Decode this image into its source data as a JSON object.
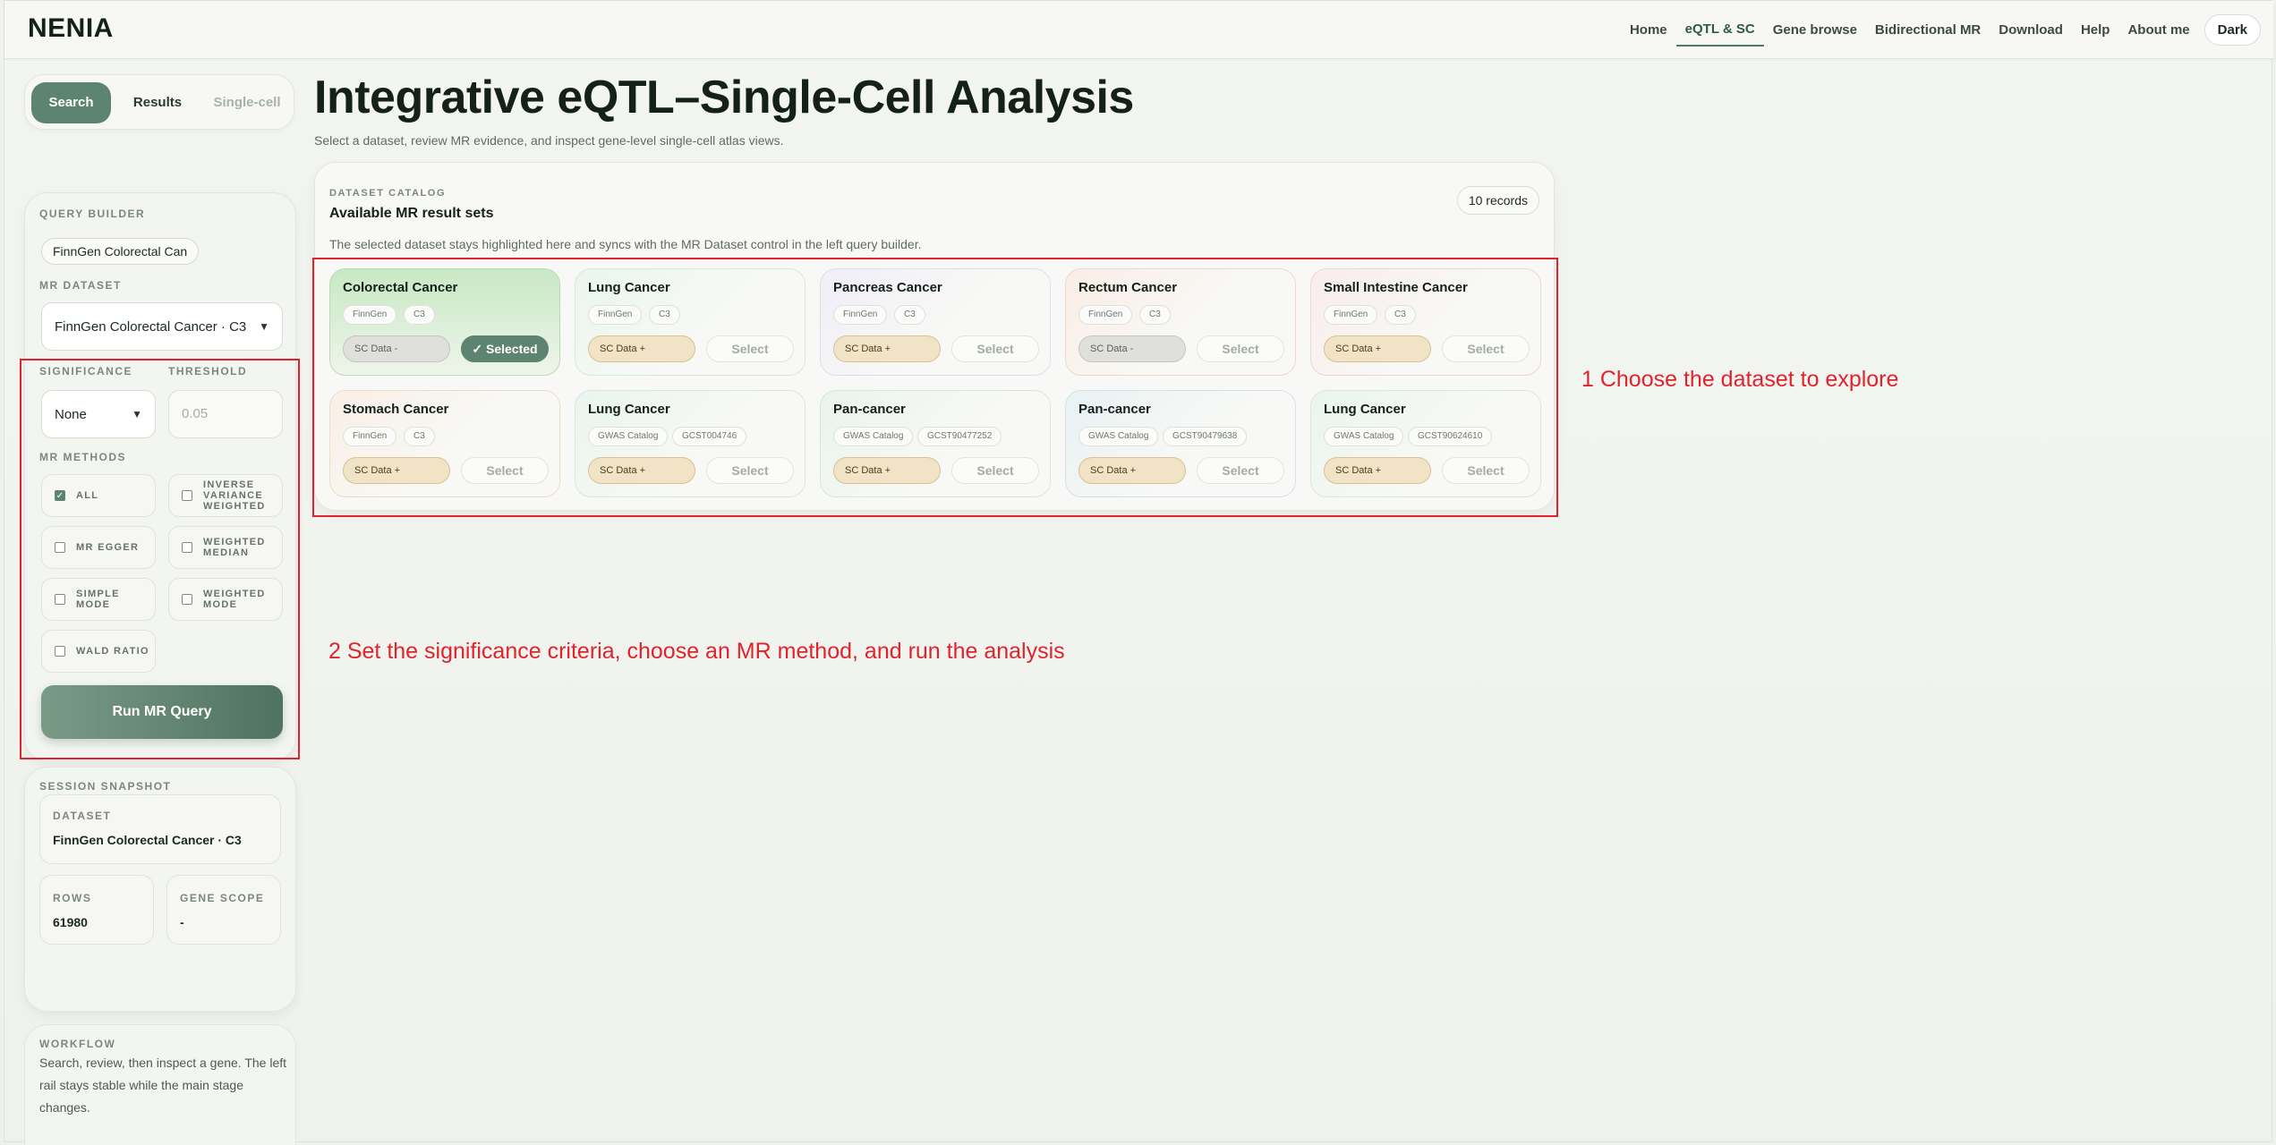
{
  "header": {
    "brand": "NENIA",
    "nav": [
      {
        "label": "Home"
      },
      {
        "label": "eQTL & SC",
        "active": true
      },
      {
        "label": "Gene browse"
      },
      {
        "label": "Bidirectional MR"
      },
      {
        "label": "Download"
      },
      {
        "label": "Help"
      },
      {
        "label": "About me"
      }
    ],
    "theme_button": "Dark"
  },
  "rail_tabs": {
    "search": "Search",
    "results": "Results",
    "single_cell": "Single-cell"
  },
  "query": {
    "kicker": "QUERY BUILDER",
    "search_value": "FinnGen Colorectal Can",
    "dataset_label": "MR DATASET",
    "dataset_value": "FinnGen Colorectal Cancer · C3",
    "significance_label": "SIGNIFICANCE",
    "significance_value": "None",
    "threshold_label": "THRESHOLD",
    "threshold_placeholder": "0.05",
    "methods_label": "MR METHODS",
    "methods": [
      {
        "label": "ALL",
        "checked": true
      },
      {
        "label": "INVERSE VARIANCE WEIGHTED",
        "checked": false
      },
      {
        "label": "MR EGGER",
        "checked": false
      },
      {
        "label": "WEIGHTED MEDIAN",
        "checked": false
      },
      {
        "label": "SIMPLE MODE",
        "checked": false
      },
      {
        "label": "WEIGHTED MODE",
        "checked": false
      },
      {
        "label": "WALD RATIO",
        "checked": false
      }
    ],
    "run_label": "Run MR Query"
  },
  "session": {
    "kicker": "SESSION SNAPSHOT",
    "dataset_label": "DATASET",
    "dataset_value": "FinnGen Colorectal Cancer · C3",
    "rows_label": "ROWS",
    "rows_value": "61980",
    "gene_scope_label": "GENE SCOPE",
    "gene_scope_value": "-"
  },
  "workflow": {
    "kicker": "WORKFLOW",
    "text": "Search, review, then inspect a gene. The left rail stays stable while the main stage changes."
  },
  "main": {
    "title": "Integrative eQTL–Single-Cell Analysis",
    "subtitle": "Select a dataset, review MR evidence, and inspect gene-level single-cell atlas views."
  },
  "catalog": {
    "kicker": "DATASET CATALOG",
    "title": "Available MR result sets",
    "description": "The selected dataset stays highlighted here and syncs with the MR Dataset control in the left query builder.",
    "records": "10 records",
    "select_label": "Select",
    "selected_label": "✓ Selected",
    "cards": [
      {
        "name": "Colorectal Cancer",
        "source": "FinnGen",
        "code": "C3",
        "sc": "SC Data -",
        "selected": true
      },
      {
        "name": "Lung Cancer",
        "source": "FinnGen",
        "code": "C3",
        "sc": "SC Data +",
        "selected": false
      },
      {
        "name": "Pancreas Cancer",
        "source": "FinnGen",
        "code": "C3",
        "sc": "SC Data +",
        "selected": false
      },
      {
        "name": "Rectum Cancer",
        "source": "FinnGen",
        "code": "C3",
        "sc": "SC Data -",
        "selected": false
      },
      {
        "name": "Small Intestine Cancer",
        "source": "FinnGen",
        "code": "C3",
        "sc": "SC Data +",
        "selected": false
      },
      {
        "name": "Stomach Cancer",
        "source": "FinnGen",
        "code": "C3",
        "sc": "SC Data +",
        "selected": false
      },
      {
        "name": "Lung Cancer",
        "source": "GWAS Catalog",
        "code": "GCST004746",
        "sc": "SC Data +",
        "selected": false
      },
      {
        "name": "Pan-cancer",
        "source": "GWAS Catalog",
        "code": "GCST90477252",
        "sc": "SC Data +",
        "selected": false
      },
      {
        "name": "Pan-cancer",
        "source": "GWAS Catalog",
        "code": "GCST90479638",
        "sc": "SC Data +",
        "selected": false
      },
      {
        "name": "Lung Cancer",
        "source": "GWAS Catalog",
        "code": "GCST90624610",
        "sc": "SC Data +",
        "selected": false
      }
    ]
  },
  "annotations": {
    "step1": "1 Choose the dataset to explore",
    "step2": "2 Set the significance criteria, choose an MR method, and run the analysis",
    "color": "#e0242e"
  }
}
